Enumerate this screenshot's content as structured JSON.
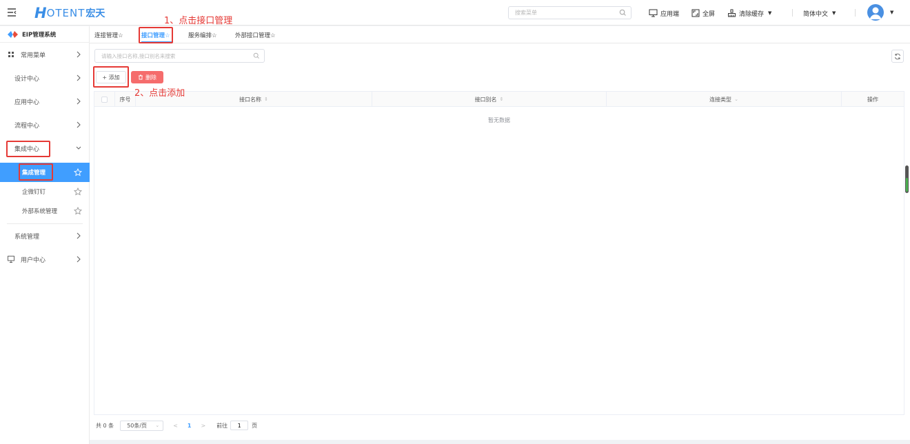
{
  "header": {
    "logo_h": "H",
    "logo_rest": "OTENT",
    "logo_cn": "宏天",
    "search_placeholder": "搜索菜单",
    "app_end": "应用端",
    "fullscreen": "全屏",
    "clear_cache": "清除缓存",
    "language": "简体中文"
  },
  "sidebar": {
    "system_title": "EIP管理系统",
    "items": [
      {
        "label": "常用菜单"
      },
      {
        "label": "设计中心"
      },
      {
        "label": "应用中心"
      },
      {
        "label": "流程中心"
      },
      {
        "label": "集成中心"
      },
      {
        "label": "系统管理"
      },
      {
        "label": "用户中心"
      }
    ],
    "sub_items": [
      {
        "label": "集成管理"
      },
      {
        "label": "企微钉钉"
      },
      {
        "label": "外部系统管理"
      }
    ]
  },
  "tabs": [
    {
      "label": "连接管理☆"
    },
    {
      "label": "接口管理☆"
    },
    {
      "label": "服务编排☆"
    },
    {
      "label": "外部接口管理☆"
    }
  ],
  "toolbar": {
    "search_placeholder": "请输入接口名称,接口别名来搜索",
    "add_label": "+ 添加",
    "delete_label": "删除"
  },
  "table": {
    "columns": [
      "序号",
      "接口名称",
      "接口别名",
      "连接类型",
      "操作"
    ],
    "empty_text": "暂无数据"
  },
  "pagination": {
    "total": "共 0 条",
    "page_size": "50条/页",
    "current_page": "1",
    "goto_label": "前往",
    "goto_value": "1",
    "page_unit": "页"
  },
  "annotations": {
    "step1": "1、点击接口管理",
    "step2": "2、点击添加"
  },
  "colors": {
    "primary": "#409eff",
    "danger": "#f56c6c",
    "annotation": "#e53935"
  }
}
